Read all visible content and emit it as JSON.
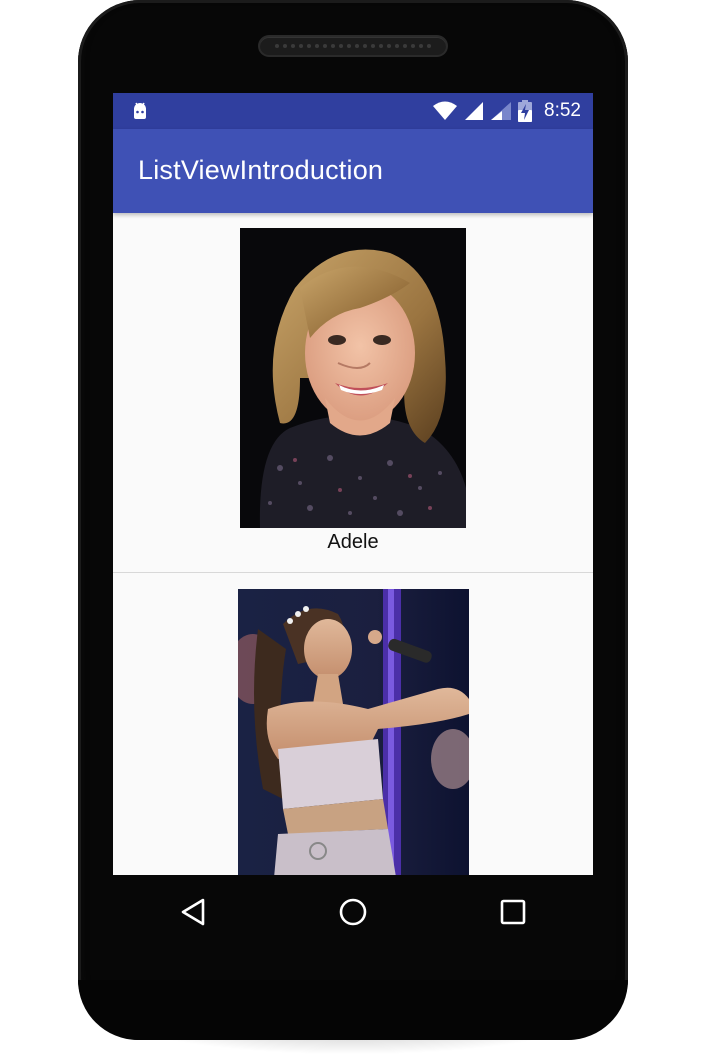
{
  "status_bar": {
    "time": "8:52",
    "icons": [
      "android-notification-icon",
      "wifi-icon",
      "signal-icon",
      "signal-weak-icon",
      "battery-charging-icon"
    ]
  },
  "app_bar": {
    "title": "ListViewIntroduction"
  },
  "list": {
    "items": [
      {
        "name": "Adele",
        "image": "adele-photo"
      },
      {
        "name": "",
        "image": "ariana-photo"
      }
    ]
  },
  "nav_bar": {
    "icons": [
      "back-icon",
      "home-icon",
      "recents-icon"
    ]
  },
  "colors": {
    "status_bar": "#303f9f",
    "app_bar": "#3f51b5",
    "list_background": "#fafafa"
  }
}
